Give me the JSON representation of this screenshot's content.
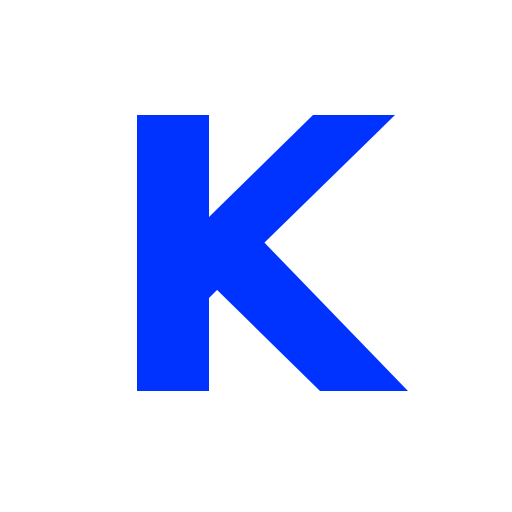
{
  "glyph": {
    "text": "K",
    "color": "#0033ff",
    "background": "#ffffff"
  }
}
